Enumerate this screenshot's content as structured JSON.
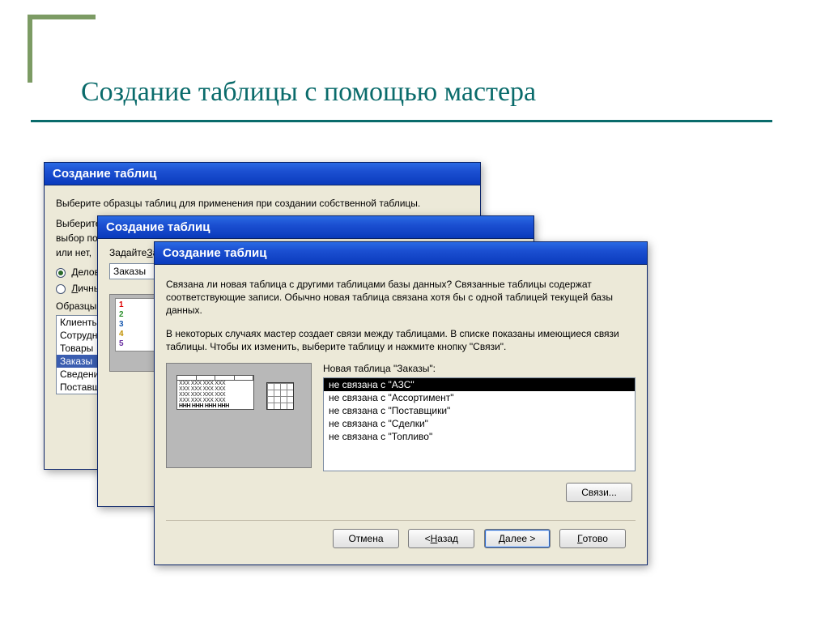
{
  "slide": {
    "title": "Создание таблицы с помощью мастера"
  },
  "dialog1": {
    "title": "Создание таблиц",
    "instr1": "Выберите образцы таблиц для применения при создании собственной таблицы.",
    "instr2a": "Выберите",
    "instr2b": "выбор по",
    "instr2c": "или нет,",
    "radio_business_u": "Д",
    "radio_business": "еловой",
    "radio_personal_u": "Л",
    "radio_personal": "ичны",
    "samples_label": "Образцы",
    "samples": [
      "Клиенты",
      "Сотрудни",
      "Товары",
      "Заказы",
      "Сведения",
      "Поставщи"
    ],
    "samples_selected_index": 3
  },
  "dialog2": {
    "title": "Создание таблиц",
    "set_label": "Задайте",
    "input_value": "Заказы"
  },
  "dialog3": {
    "title": "Создание таблиц",
    "para1": "Связана ли новая таблица с другими таблицами базы данных? Связанные таблицы содержат соответствующие записи. Обычно новая таблица связана хотя бы с одной таблицей текущей базы данных.",
    "para2": "В некоторых случаях мастер создает связи между таблицами. В списке показаны имеющиеся связи таблицы. Чтобы их изменить, выберите таблицу и нажмите кнопку \"Связи\".",
    "rel_label": "Новая таблица \"Заказы\":",
    "relations": [
      "не связана с \"АЗС\"",
      "не связана с \"Ассортимент\"",
      "не связана с \"Поставщики\"",
      "не связана с \"Сделки\"",
      "не связана с \"Топливо\""
    ],
    "relations_selected_index": 0,
    "btn_relations": "Связи...",
    "btn_cancel": "Отмена",
    "btn_back_lt": "< ",
    "btn_back_u": "Н",
    "btn_back_rest": "азад",
    "btn_next_u": "Д",
    "btn_next_rest": "алее >",
    "btn_finish_u": "Г",
    "btn_finish_rest": "отово"
  },
  "mini_rows": [
    "XXX XXX XXX XXX",
    "XXX XXX XXX XXX",
    "XXX XXX XXX XXX",
    "XXX XXX XXX XXX",
    "HHH HHH HHH HHH"
  ]
}
